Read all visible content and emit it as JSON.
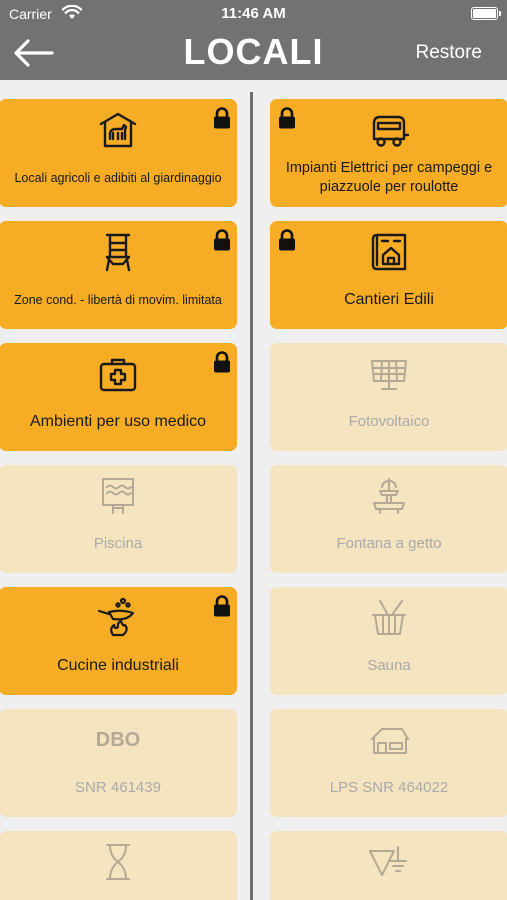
{
  "status_bar": {
    "carrier": "Carrier",
    "time": "11:46 AM"
  },
  "nav": {
    "title": "LOCALI",
    "restore_label": "Restore"
  },
  "tiles": {
    "agricoli": {
      "label": "Locali agricoli e adibiti al giardinaggio",
      "icon": "barn-horse-icon",
      "locked": true
    },
    "campeggi": {
      "label": "Impianti Elettrici per campeggi e piazzuole per roulotte",
      "icon": "caravan-icon",
      "locked": true
    },
    "zone": {
      "label": "Zone cond. - libertà di movim. limitata",
      "icon": "silo-icon",
      "locked": true
    },
    "cantieri": {
      "label": "Cantieri Edili",
      "icon": "blueprint-house-icon",
      "locked": true
    },
    "medico": {
      "label": "Ambienti per uso medico",
      "icon": "first-aid-kit-icon",
      "locked": true
    },
    "fotovoltaico": {
      "label": "Fotovoltaico",
      "icon": "solar-panel-icon",
      "locked": false
    },
    "piscina": {
      "label": "Piscina",
      "icon": "pool-icon",
      "locked": false
    },
    "fontana": {
      "label": "Fontana a getto",
      "icon": "fountain-icon",
      "locked": false
    },
    "cucine": {
      "label": "Cucine industriali",
      "icon": "cooking-pan-icon",
      "locked": true
    },
    "sauna": {
      "label": "Sauna",
      "icon": "sauna-bucket-icon",
      "locked": false
    },
    "snr": {
      "label": "SNR 461439",
      "icon_text": "DBO",
      "locked": false
    },
    "lps": {
      "label": "LPS SNR 464022",
      "icon": "house-icon",
      "locked": false
    },
    "bottom_left": {
      "icon": "hourglass-icon",
      "locked": false
    },
    "bottom_right": {
      "icon": "grounding-icon",
      "locked": false
    }
  },
  "colors": {
    "active_tile": "#f6ad25",
    "inactive_tile": "#f5e4c0",
    "nav_bar": "#727272",
    "background": "#efefef"
  }
}
